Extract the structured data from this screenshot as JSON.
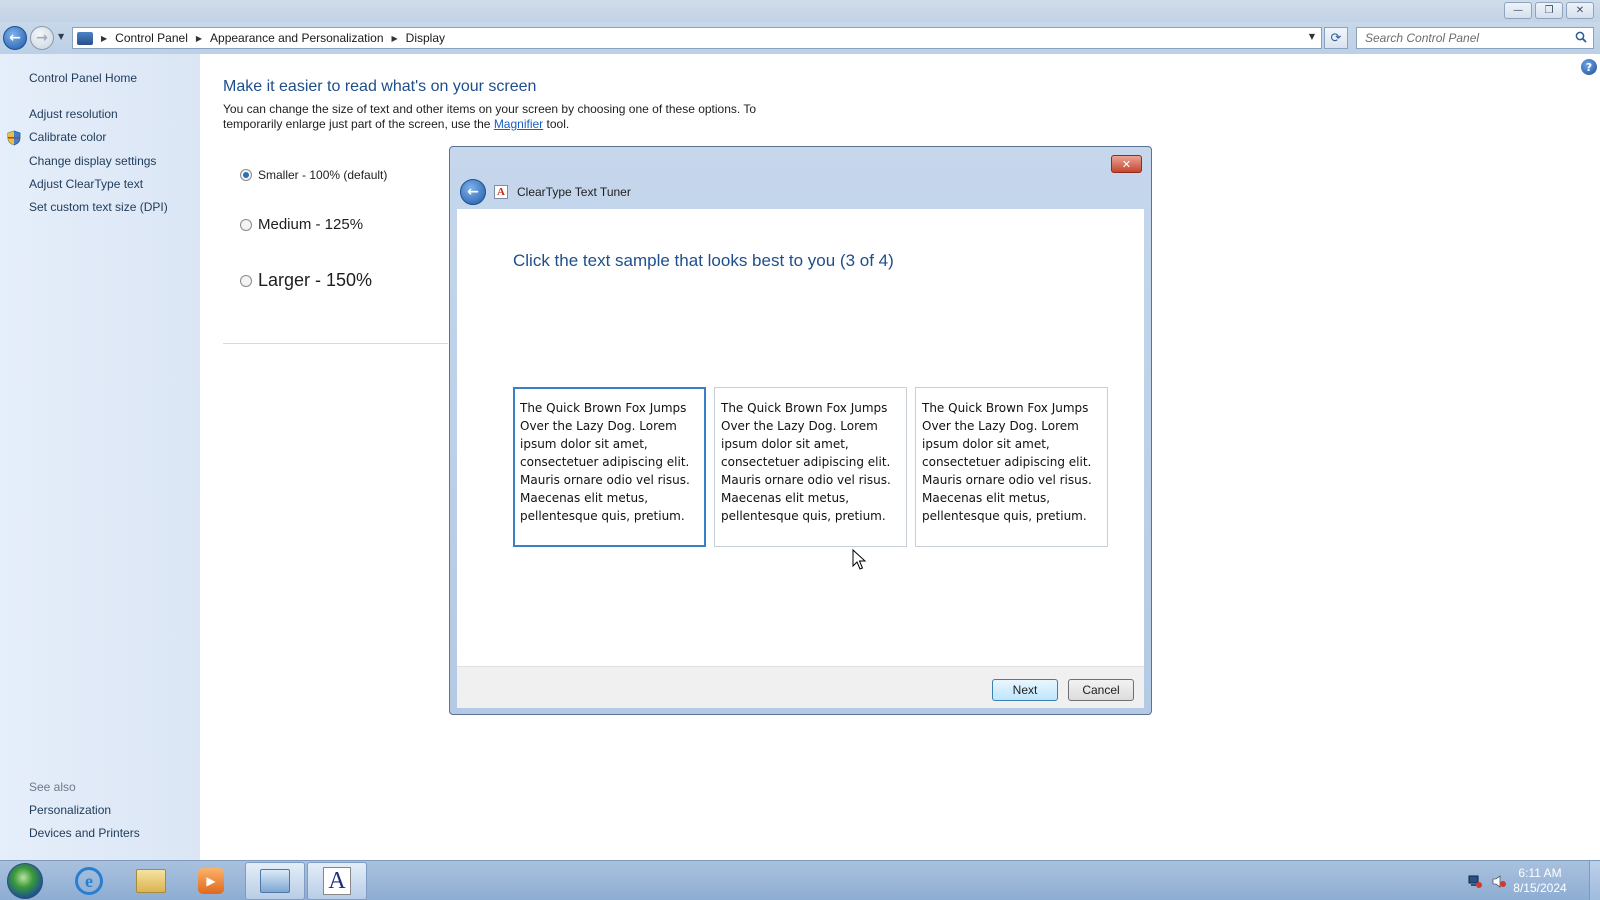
{
  "window": {
    "controls": {
      "minimize": "—",
      "maximize": "❐",
      "close": "✕"
    }
  },
  "addressbar": {
    "breadcrumbs": [
      "Control Panel",
      "Appearance and Personalization",
      "Display"
    ],
    "search_placeholder": "Search Control Panel"
  },
  "sidebar": {
    "links": [
      "Control Panel Home",
      "Adjust resolution",
      "Calibrate color",
      "Change display settings",
      "Adjust ClearType text",
      "Set custom text size (DPI)"
    ],
    "see_also_label": "See also",
    "see_also": [
      "Personalization",
      "Devices and Printers"
    ]
  },
  "main": {
    "title": "Make it easier to read what's on your screen",
    "description_before": "You can change the size of text and other items on your screen by choosing one of these options. To temporarily enlarge just part of the screen, use the ",
    "magnifier_link": "Magnifier",
    "description_after": " tool.",
    "options": [
      {
        "label": "Smaller - 100% (default)",
        "selected": true
      },
      {
        "label": "Medium - 125%",
        "selected": false
      },
      {
        "label": "Larger - 150%",
        "selected": false
      }
    ]
  },
  "dialog": {
    "title": "ClearType Text Tuner",
    "heading": "Click the text sample that looks best to you (3 of 4)",
    "samples": [
      "The Quick Brown Fox Jumps Over the Lazy Dog. Lorem ipsum dolor sit amet, consectetuer adipiscing elit. Mauris ornare odio vel risus. Maecenas elit metus, pellentesque quis, pretium.",
      "The Quick Brown Fox Jumps Over the Lazy Dog. Lorem ipsum dolor sit amet, consectetuer adipiscing elit. Mauris ornare odio vel risus. Maecenas elit metus, pellentesque quis, pretium.",
      "The Quick Brown Fox Jumps Over the Lazy Dog. Lorem ipsum dolor sit amet, consectetuer adipiscing elit. Mauris ornare odio vel risus. Maecenas elit metus, pellentesque quis, pretium."
    ],
    "selected_sample": 0,
    "next_label": "Next",
    "cancel_label": "Cancel"
  },
  "taskbar": {
    "time": "6:11 AM",
    "date": "8/15/2024",
    "font_app_glyph": "A"
  },
  "colors": {
    "heading_blue": "#1e4e8c",
    "link_blue": "#1a5fbf",
    "selection_border": "#3b7fc4",
    "taskbar": "#9db8da"
  }
}
